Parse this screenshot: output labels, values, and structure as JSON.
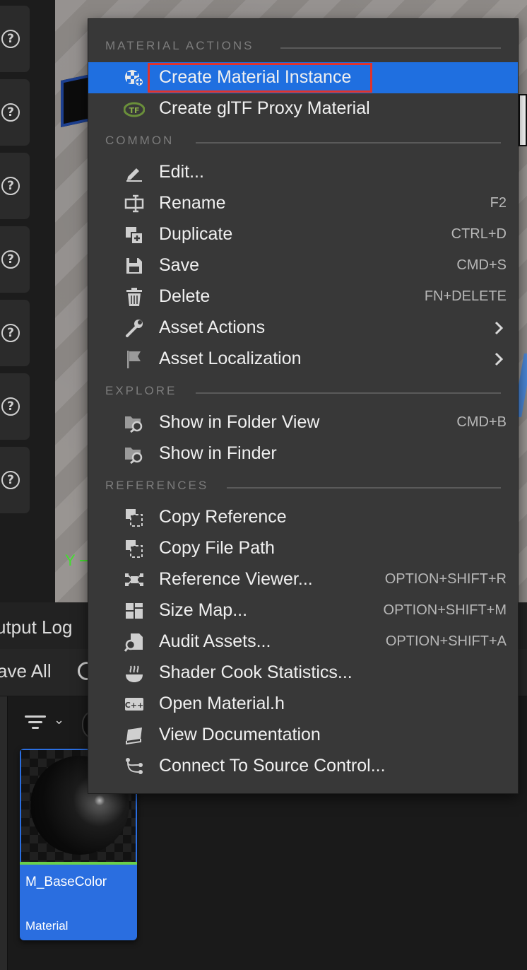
{
  "menu": {
    "sections": [
      {
        "title": "MATERIAL ACTIONS"
      },
      {
        "title": "COMMON"
      },
      {
        "title": "EXPLORE"
      },
      {
        "title": "REFERENCES"
      }
    ],
    "items": [
      {
        "label": "Create Material Instance",
        "shortcut": "",
        "icon": "material-instance-icon",
        "highlighted": true
      },
      {
        "label": "Create glTF Proxy Material",
        "shortcut": "",
        "icon": "gltf-icon"
      },
      {
        "label": "Edit...",
        "shortcut": "",
        "icon": "pencil-icon"
      },
      {
        "label": "Rename",
        "shortcut": "F2",
        "icon": "rename-icon"
      },
      {
        "label": "Duplicate",
        "shortcut": "CTRL+D",
        "icon": "duplicate-icon"
      },
      {
        "label": "Save",
        "shortcut": "CMD+S",
        "icon": "save-icon"
      },
      {
        "label": "Delete",
        "shortcut": "FN+DELETE",
        "icon": "trash-icon"
      },
      {
        "label": "Asset Actions",
        "shortcut": "",
        "icon": "wrench-icon",
        "submenu": true
      },
      {
        "label": "Asset Localization",
        "shortcut": "",
        "icon": "flag-icon",
        "submenu": true
      },
      {
        "label": "Show in Folder View",
        "shortcut": "CMD+B",
        "icon": "folder-search-icon"
      },
      {
        "label": "Show in Finder",
        "shortcut": "",
        "icon": "folder-search-icon"
      },
      {
        "label": "Copy Reference",
        "shortcut": "",
        "icon": "copy-icon"
      },
      {
        "label": "Copy File Path",
        "shortcut": "",
        "icon": "copy-icon"
      },
      {
        "label": "Reference Viewer...",
        "shortcut": "OPTION+SHIFT+R",
        "icon": "reference-viewer-icon"
      },
      {
        "label": "Size Map...",
        "shortcut": "OPTION+SHIFT+M",
        "icon": "size-map-icon"
      },
      {
        "label": "Audit Assets...",
        "shortcut": "OPTION+SHIFT+A",
        "icon": "audit-icon"
      },
      {
        "label": "Shader Cook Statistics...",
        "shortcut": "",
        "icon": "steam-bowl-icon"
      },
      {
        "label": "Open Material.h",
        "shortcut": "",
        "icon": "cpp-icon"
      },
      {
        "label": "View Documentation",
        "shortcut": "",
        "icon": "book-icon"
      },
      {
        "label": "Connect To Source Control...",
        "shortcut": "",
        "icon": "source-control-icon"
      }
    ]
  },
  "panel": {
    "tab_label": "utput Log",
    "save_all_label": "ave All"
  },
  "asset": {
    "name": "M_BaseColor",
    "type": "Material"
  },
  "viewport": {
    "axis_label": "Y"
  },
  "colors": {
    "highlight": "#1f6fe0",
    "callout": "#e0332b",
    "menu_bg": "#383838"
  }
}
